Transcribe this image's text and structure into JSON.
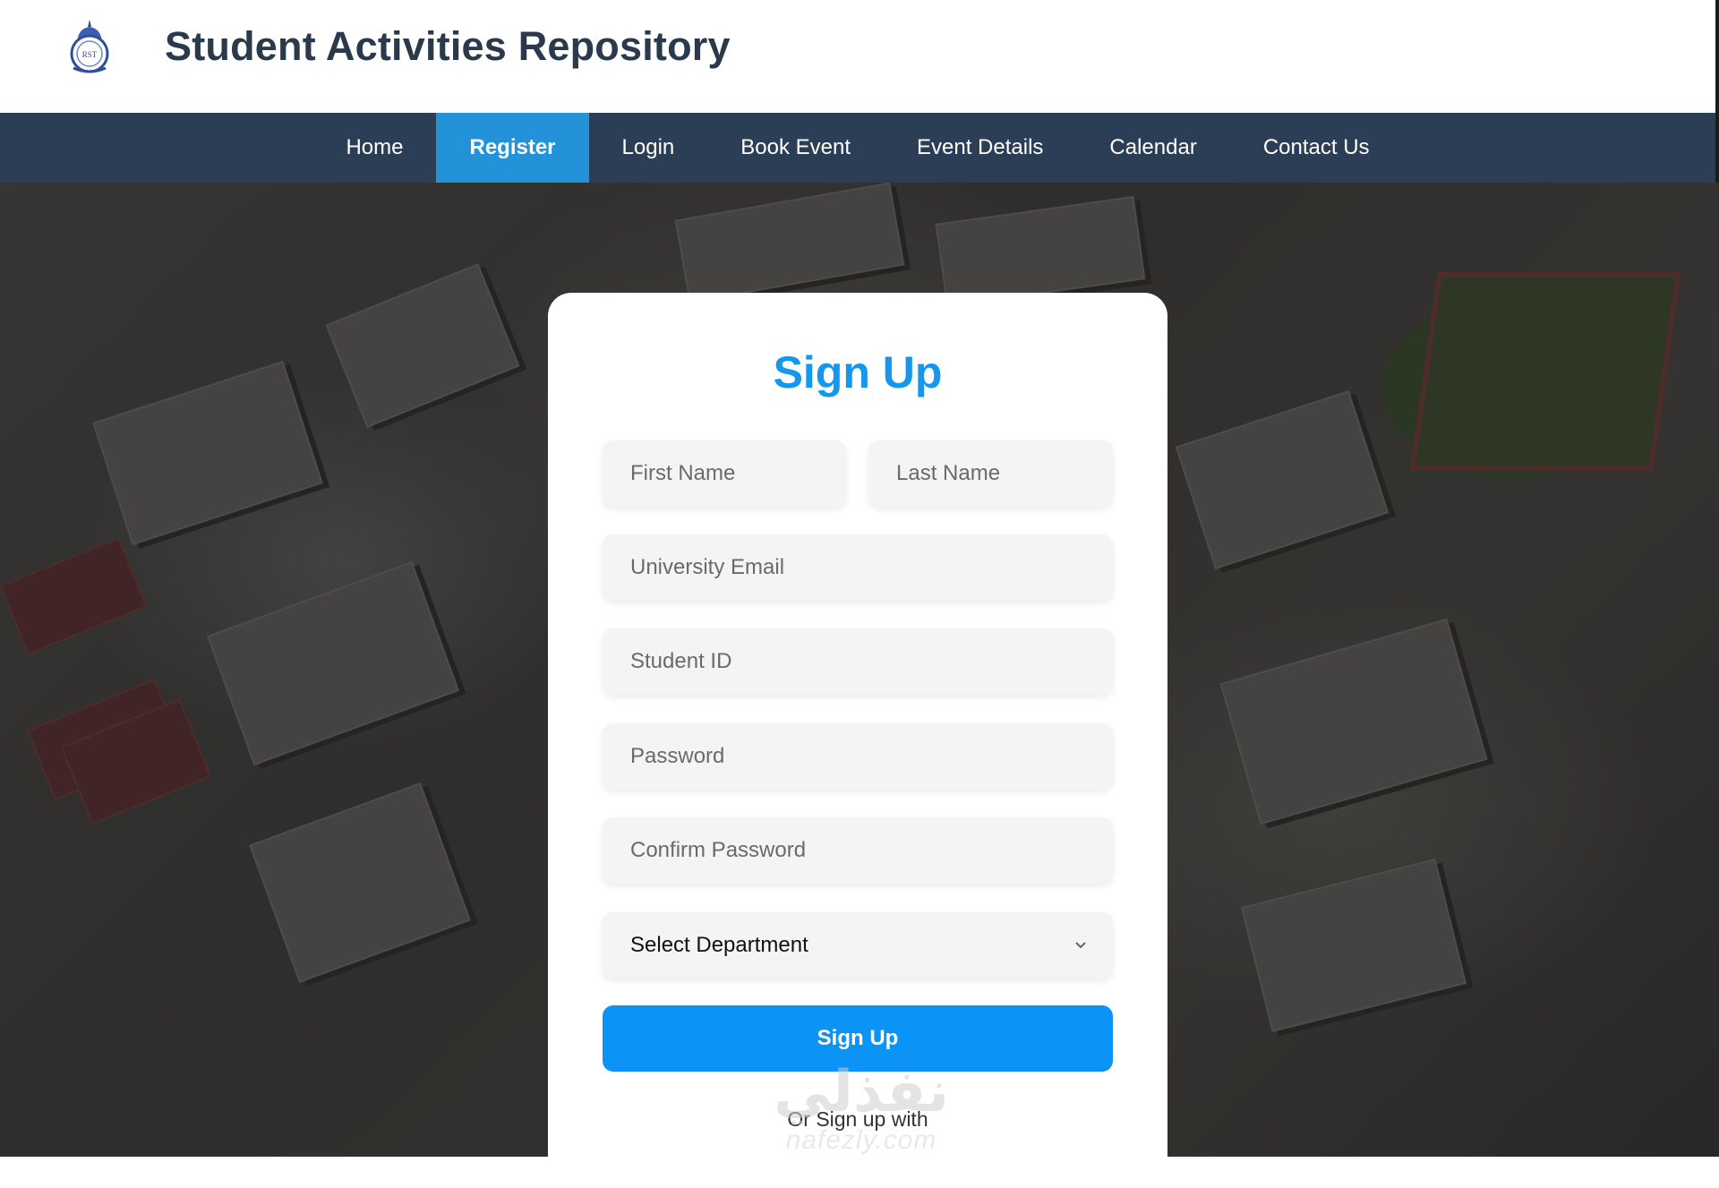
{
  "header": {
    "logo_icon": "university-crest-icon",
    "logo_text": "RST",
    "title": "Student Activities Repository"
  },
  "nav": {
    "items": [
      {
        "label": "Home",
        "active": false
      },
      {
        "label": "Register",
        "active": true
      },
      {
        "label": "Login",
        "active": false
      },
      {
        "label": "Book Event",
        "active": false
      },
      {
        "label": "Event Details",
        "active": false
      },
      {
        "label": "Calendar",
        "active": false
      },
      {
        "label": "Contact Us",
        "active": false
      }
    ]
  },
  "form": {
    "title": "Sign Up",
    "first_name_placeholder": "First Name",
    "last_name_placeholder": "Last Name",
    "email_placeholder": "University Email",
    "student_id_placeholder": "Student ID",
    "password_placeholder": "Password",
    "confirm_password_placeholder": "Confirm Password",
    "department_selected": "Select Department",
    "submit_label": "Sign Up",
    "alt_signup_text": "Or Sign up with"
  },
  "watermark": {
    "arabic": "نفذلي",
    "latin": "nafezly.com"
  },
  "colors": {
    "title_dark": "#2a3a4c",
    "navbar": "#2c3e55",
    "nav_active": "#2392d9",
    "primary": "#0b93f5",
    "heading": "#1497ec"
  }
}
